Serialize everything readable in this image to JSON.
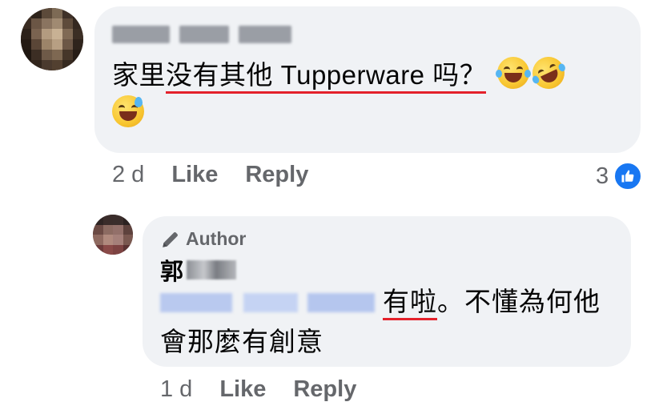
{
  "main_comment": {
    "text_plain": "家里",
    "text_underlined": "没有其他 Tupperware 吗？",
    "emojis": [
      "face-with-tears-of-joy",
      "rolling-on-floor-laughing",
      "grinning-face-with-sweat"
    ],
    "time": "2 d",
    "like_label": "Like",
    "reply_label": "Reply",
    "reaction_count": "3"
  },
  "reply_comment": {
    "badge_label": "Author",
    "name_visible": "郭",
    "text_underlined": "有啦",
    "text_rest": "。不懂為何他會那麼有創意",
    "time": "1 d",
    "like_label": "Like",
    "reply_label": "Reply"
  },
  "colors": {
    "bubble": "#f0f2f5",
    "secondary_text": "#65676b",
    "like_blue": "#1877f2",
    "underline_red": "#e4212b"
  }
}
